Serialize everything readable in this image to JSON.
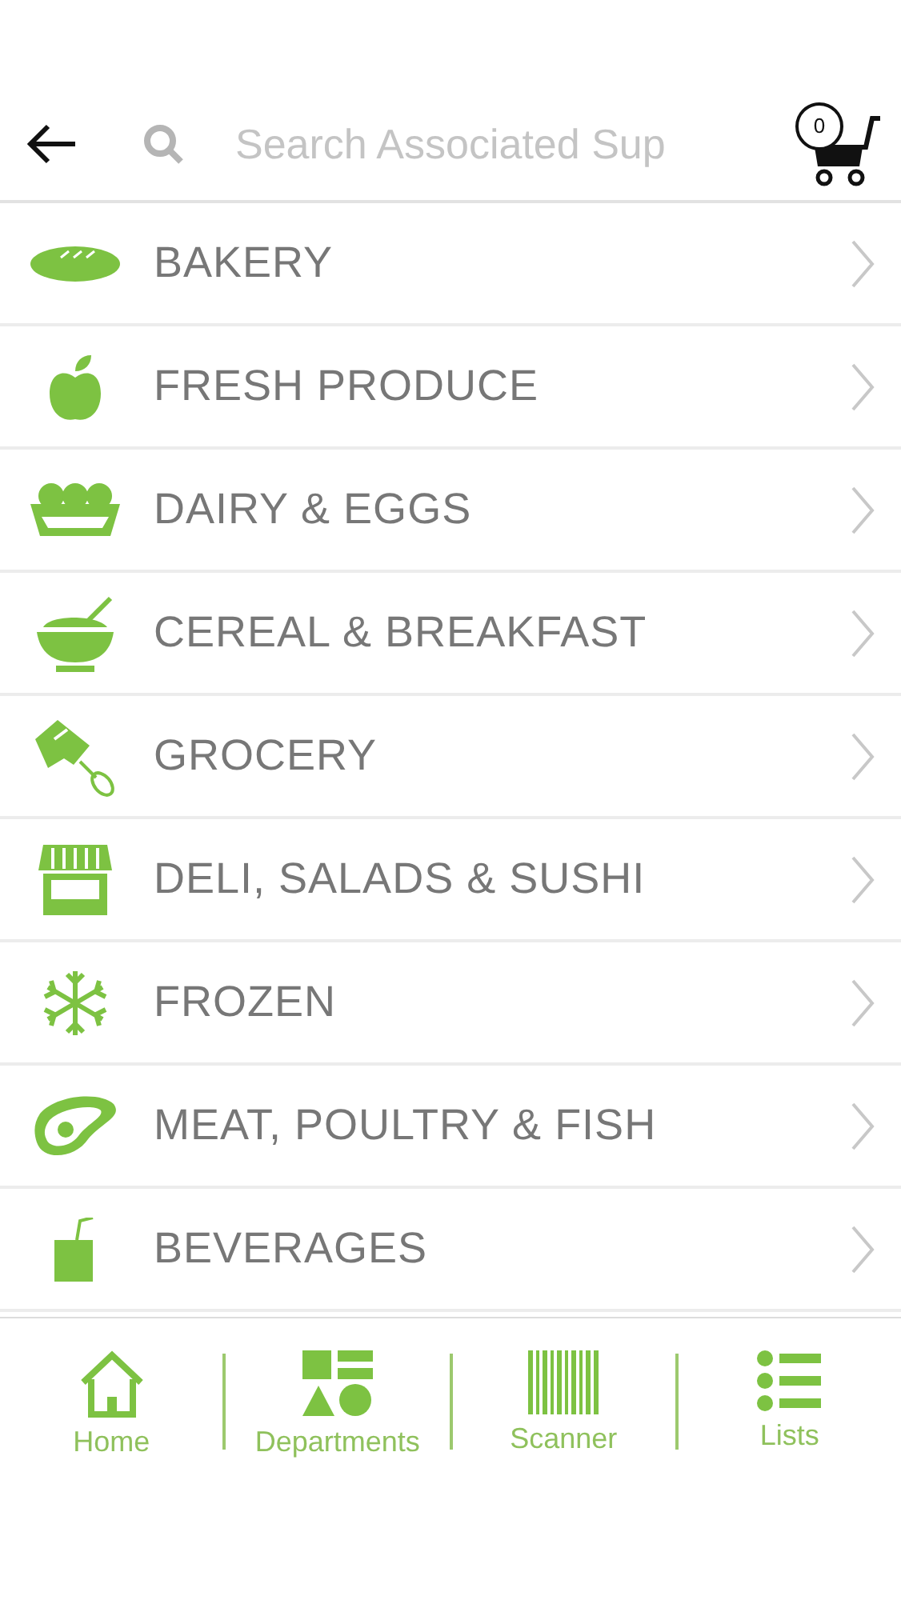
{
  "search": {
    "placeholder": "Search Associated Sup"
  },
  "cart": {
    "count": "0"
  },
  "departments": [
    {
      "label": "BAKERY"
    },
    {
      "label": "FRESH PRODUCE"
    },
    {
      "label": "DAIRY & EGGS"
    },
    {
      "label": "CEREAL & BREAKFAST"
    },
    {
      "label": "GROCERY"
    },
    {
      "label": "DELI, SALADS & SUSHI"
    },
    {
      "label": "FROZEN"
    },
    {
      "label": "MEAT, POULTRY & FISH"
    },
    {
      "label": "BEVERAGES"
    }
  ],
  "tab_bar": [
    {
      "label": "Home"
    },
    {
      "label": "Departments"
    },
    {
      "label": "Scanner"
    },
    {
      "label": "Lists"
    }
  ]
}
